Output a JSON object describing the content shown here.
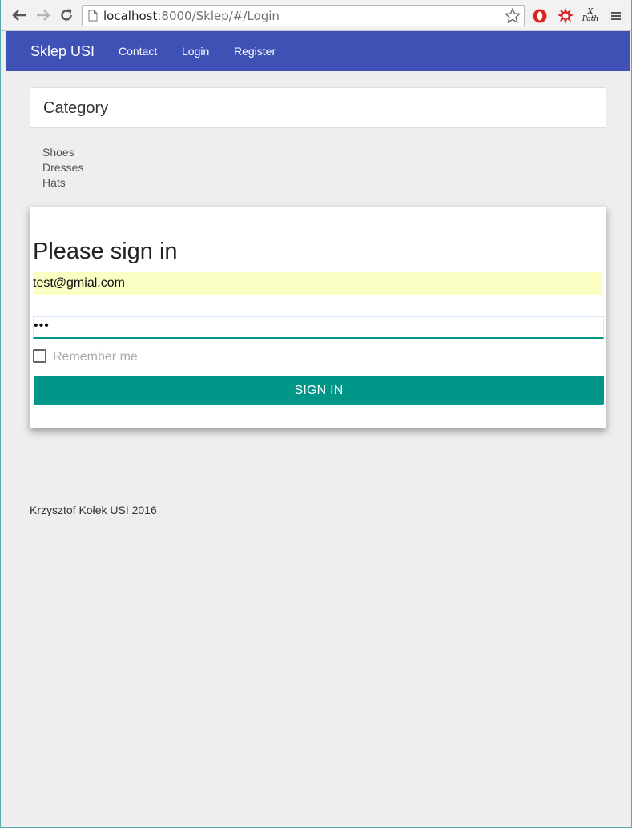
{
  "browser": {
    "url_host": "localhost",
    "url_rest": ":8000/Sklep/#/Login",
    "xpath_ext_top": "X",
    "xpath_ext_bottom": "Path"
  },
  "navbar": {
    "brand": "Sklep USI",
    "links": [
      "Contact",
      "Login",
      "Register"
    ],
    "color": "#3f51b5"
  },
  "category": {
    "title": "Category",
    "items": [
      "Shoes",
      "Dresses",
      "Hats"
    ]
  },
  "login": {
    "title": "Please sign in",
    "email_value": "test@gmial.com",
    "password_mask": "•••",
    "remember_label": "Remember me",
    "remember_checked": false,
    "submit_label": "SIGN IN",
    "accent": "#009688"
  },
  "footer": {
    "text": "Krzysztof Kołek USI 2016"
  }
}
